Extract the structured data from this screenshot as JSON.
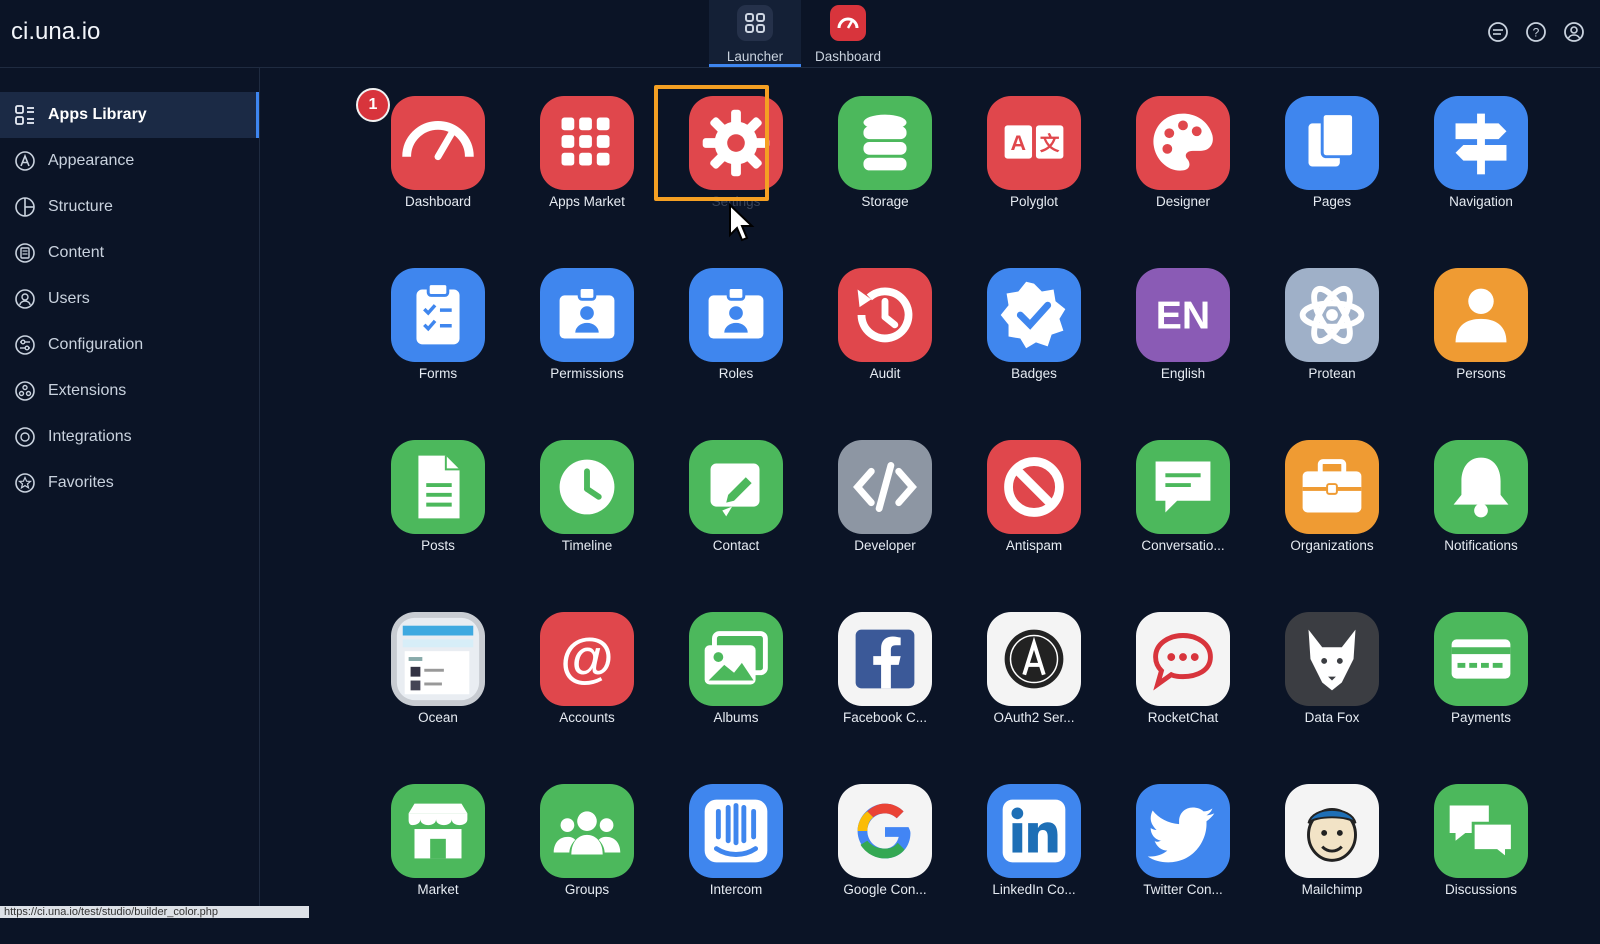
{
  "brand": "ci.una.io",
  "top_tabs": [
    {
      "label": "Launcher",
      "icon": "grid-icon",
      "active": true
    },
    {
      "label": "Dashboard",
      "icon": "speedometer-icon",
      "active": false
    }
  ],
  "top_right_icons": [
    "chat-icon",
    "help-icon",
    "account-icon"
  ],
  "sidebar": {
    "items": [
      {
        "label": "Apps Library",
        "icon": "apps-library-icon",
        "active": true
      },
      {
        "label": "Appearance",
        "icon": "appearance-icon"
      },
      {
        "label": "Structure",
        "icon": "structure-icon"
      },
      {
        "label": "Content",
        "icon": "content-icon"
      },
      {
        "label": "Users",
        "icon": "users-icon"
      },
      {
        "label": "Configuration",
        "icon": "configuration-icon"
      },
      {
        "label": "Extensions",
        "icon": "extensions-icon"
      },
      {
        "label": "Integrations",
        "icon": "integrations-icon"
      },
      {
        "label": "Favorites",
        "icon": "favorites-icon"
      }
    ]
  },
  "notification_badge": "1",
  "apps": [
    {
      "label": "Dashboard",
      "icon": "speedometer-icon",
      "color": "#e0474c"
    },
    {
      "label": "Apps Market",
      "icon": "app-grid-icon",
      "color": "#e0474c"
    },
    {
      "label": "Settings",
      "icon": "gear-icon",
      "color": "#e0474c"
    },
    {
      "label": "Storage",
      "icon": "database-icon",
      "color": "#4cb85c"
    },
    {
      "label": "Polyglot",
      "icon": "translate-icon",
      "color": "#e0474c"
    },
    {
      "label": "Designer",
      "icon": "palette-icon",
      "color": "#e0474c"
    },
    {
      "label": "Pages",
      "icon": "pages-icon",
      "color": "#3f86ee"
    },
    {
      "label": "Navigation",
      "icon": "signpost-icon",
      "color": "#3f86ee"
    },
    {
      "label": "Forms",
      "icon": "clipboard-icon",
      "color": "#3f86ee"
    },
    {
      "label": "Permissions",
      "icon": "id-badge-icon",
      "color": "#3f86ee"
    },
    {
      "label": "Roles",
      "icon": "id-badge-icon",
      "color": "#3f86ee"
    },
    {
      "label": "Audit",
      "icon": "history-icon",
      "color": "#e0474c"
    },
    {
      "label": "Badges",
      "icon": "verified-badge-icon",
      "color": "#3f86ee"
    },
    {
      "label": "English",
      "icon": "language-en-icon",
      "color": "#8a5bb5"
    },
    {
      "label": "Protean",
      "icon": "atom-icon",
      "color": "#9fb0c8"
    },
    {
      "label": "Persons",
      "icon": "person-icon",
      "color": "#ef9b33"
    },
    {
      "label": "Posts",
      "icon": "document-icon",
      "color": "#4cb85c"
    },
    {
      "label": "Timeline",
      "icon": "clock-icon",
      "color": "#4cb85c"
    },
    {
      "label": "Contact",
      "icon": "edit-icon",
      "color": "#4cb85c"
    },
    {
      "label": "Developer",
      "icon": "code-icon",
      "color": "#8d96a3"
    },
    {
      "label": "Antispam",
      "icon": "block-icon",
      "color": "#e0474c"
    },
    {
      "label": "Conversatio...",
      "icon": "message-icon",
      "color": "#4cb85c"
    },
    {
      "label": "Organizations",
      "icon": "briefcase-icon",
      "color": "#ef9b33"
    },
    {
      "label": "Notifications",
      "icon": "bell-icon",
      "color": "#4cb85c"
    },
    {
      "label": "Ocean",
      "icon": "ocean-screenshot-icon",
      "color": "#c8ccd2"
    },
    {
      "label": "Accounts",
      "icon": "at-icon",
      "color": "#e0474c"
    },
    {
      "label": "Albums",
      "icon": "images-icon",
      "color": "#4cb85c"
    },
    {
      "label": "Facebook C...",
      "icon": "facebook-icon",
      "color": "#f4f4f4"
    },
    {
      "label": "OAuth2 Ser...",
      "icon": "oauth-icon",
      "color": "#f4f4f4"
    },
    {
      "label": "RocketChat",
      "icon": "rocketchat-icon",
      "color": "#f4f4f4"
    },
    {
      "label": "Data Fox",
      "icon": "fox-icon",
      "color": "#3b3d42"
    },
    {
      "label": "Payments",
      "icon": "card-icon",
      "color": "#4cb85c"
    },
    {
      "label": "Market",
      "icon": "store-icon",
      "color": "#4cb85c"
    },
    {
      "label": "Groups",
      "icon": "group-icon",
      "color": "#4cb85c"
    },
    {
      "label": "Intercom",
      "icon": "intercom-icon",
      "color": "#3f86ee"
    },
    {
      "label": "Google Con...",
      "icon": "google-icon",
      "color": "#f4f4f4"
    },
    {
      "label": "LinkedIn Co...",
      "icon": "linkedin-icon",
      "color": "#3f86ee"
    },
    {
      "label": "Twitter Con...",
      "icon": "twitter-icon",
      "color": "#3f86ee"
    },
    {
      "label": "Mailchimp",
      "icon": "mailchimp-icon",
      "color": "#f4f4f4"
    },
    {
      "label": "Discussions",
      "icon": "discussion-icon",
      "color": "#4cb85c"
    }
  ],
  "status_url": "https://ci.una.io/test/studio/builder_color.php"
}
